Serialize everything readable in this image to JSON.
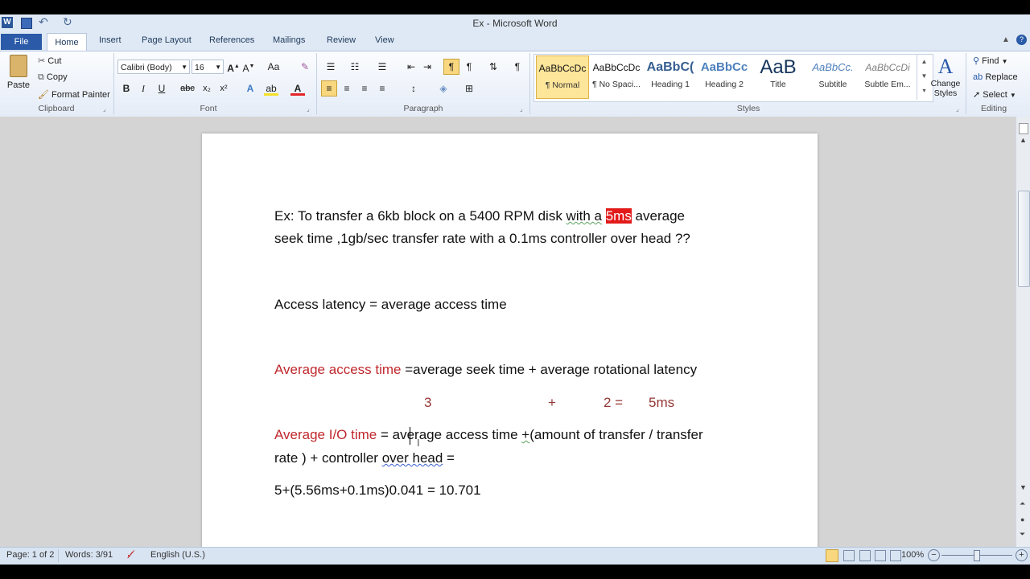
{
  "window": {
    "title": "Ex - Microsoft Word"
  },
  "tabs": {
    "file": "File",
    "home": "Home",
    "insert": "Insert",
    "page_layout": "Page Layout",
    "references": "References",
    "mailings": "Mailings",
    "review": "Review",
    "view": "View"
  },
  "clipboard": {
    "paste": "Paste",
    "cut": "Cut",
    "copy": "Copy",
    "format_painter": "Format Painter",
    "label": "Clipboard"
  },
  "font": {
    "name": "Calibri (Body)",
    "size": "16",
    "label": "Font"
  },
  "paragraph": {
    "label": "Paragraph"
  },
  "styles": {
    "label": "Styles",
    "items": [
      {
        "sample": "AaBbCcDc",
        "name": "¶ Normal"
      },
      {
        "sample": "AaBbCcDc",
        "name": "¶ No Spaci..."
      },
      {
        "sample": "AaBbC(",
        "name": "Heading 1"
      },
      {
        "sample": "AaBbCc",
        "name": "Heading 2"
      },
      {
        "sample": "AaB",
        "name": "Title"
      },
      {
        "sample": "AaBbCc.",
        "name": "Subtitle"
      },
      {
        "sample": "AaBbCcDi",
        "name": "Subtle Em..."
      }
    ],
    "change_styles": "Change Styles"
  },
  "editing": {
    "find": "Find",
    "replace": "Replace",
    "select": "Select",
    "label": "Editing"
  },
  "document": {
    "line1_a": "Ex: To transfer a 6kb block on a 5400 RPM disk ",
    "line1_with": "with  a",
    "line1_hl": "5ms",
    "line1_b": " average",
    "line2": "seek time ,1gb/sec transfer rate with a 0.1ms controller over head ??",
    "line3": "Access latency = average access time",
    "line4_red": "Average access time",
    "line4_rest": " =average seek time + average rotational latency",
    "line5_3": "3",
    "line5_plus": "+",
    "line5_2": "2 =",
    "line5_5ms": "5ms",
    "line6_red": "Average I/O time",
    "line6_a": " = average access time ",
    "line6_plus": "+",
    "line6_b": "(amount of transfer / transfer",
    "line7_a": "rate ) + controller ",
    "line7_over": "over head",
    "line7_b": " =",
    "line8": "5+(5.56ms+0.1ms)0.041 = 10.701"
  },
  "status": {
    "page": "Page: 1 of 2",
    "words": "Words: 3/91",
    "language": "English (U.S.)",
    "zoom": "100%"
  }
}
